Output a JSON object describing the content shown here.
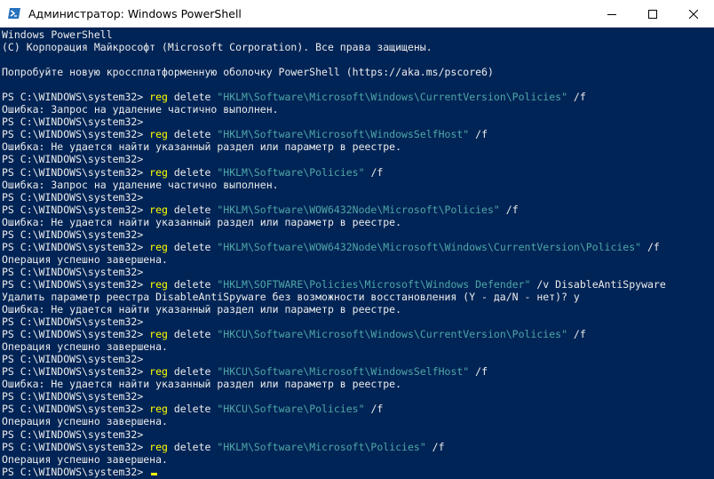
{
  "window": {
    "title": "Администратор: Windows PowerShell",
    "icon": "powershell-icon",
    "controls": [
      "minimize-icon",
      "maximize-icon",
      "close-icon"
    ]
  },
  "colors": {
    "background": "#012456",
    "text": "#ececec",
    "command": "#ffff00",
    "string": "#4fa6a6"
  },
  "console": {
    "lines": [
      {
        "type": "text",
        "text": "Windows PowerShell"
      },
      {
        "type": "text",
        "text": "(C) Корпорация Майкрософт (Microsoft Corporation). Все права защищены."
      },
      {
        "type": "text",
        "text": ""
      },
      {
        "type": "text",
        "text": "Попробуйте новую кроссплатформенную оболочку PowerShell (https://aka.ms/pscore6)"
      },
      {
        "type": "text",
        "text": ""
      },
      {
        "type": "cmd",
        "prompt": "PS C:\\WINDOWS\\system32> ",
        "command": "reg",
        "args": " delete ",
        "path": "\"HKLM\\Software\\Microsoft\\Windows\\CurrentVersion\\Policies\"",
        "tail": " /f"
      },
      {
        "type": "text",
        "text": "Ошибка: Запрос на удаление частично выполнен."
      },
      {
        "type": "text",
        "text": "PS C:\\WINDOWS\\system32>"
      },
      {
        "type": "cmd",
        "prompt": "PS C:\\WINDOWS\\system32> ",
        "command": "reg",
        "args": " delete ",
        "path": "\"HKLM\\Software\\Microsoft\\WindowsSelfHost\"",
        "tail": " /f"
      },
      {
        "type": "text",
        "text": "Ошибка: Не удается найти указанный раздел или параметр в реестре."
      },
      {
        "type": "text",
        "text": "PS C:\\WINDOWS\\system32>"
      },
      {
        "type": "cmd",
        "prompt": "PS C:\\WINDOWS\\system32> ",
        "command": "reg",
        "args": " delete ",
        "path": "\"HKLM\\Software\\Policies\"",
        "tail": " /f"
      },
      {
        "type": "text",
        "text": "Ошибка: Запрос на удаление частично выполнен."
      },
      {
        "type": "text",
        "text": "PS C:\\WINDOWS\\system32>"
      },
      {
        "type": "cmd",
        "prompt": "PS C:\\WINDOWS\\system32> ",
        "command": "reg",
        "args": " delete ",
        "path": "\"HKLM\\Software\\WOW6432Node\\Microsoft\\Policies\"",
        "tail": " /f"
      },
      {
        "type": "text",
        "text": "Ошибка: Не удается найти указанный раздел или параметр в реестре."
      },
      {
        "type": "text",
        "text": "PS C:\\WINDOWS\\system32>"
      },
      {
        "type": "cmd",
        "prompt": "PS C:\\WINDOWS\\system32> ",
        "command": "reg",
        "args": " delete ",
        "path": "\"HKLM\\Software\\WOW6432Node\\Microsoft\\Windows\\CurrentVersion\\Policies\"",
        "tail": " /f"
      },
      {
        "type": "text",
        "text": "Операция успешно завершена."
      },
      {
        "type": "text",
        "text": "PS C:\\WINDOWS\\system32>"
      },
      {
        "type": "cmd",
        "prompt": "PS C:\\WINDOWS\\system32> ",
        "command": "reg",
        "args": " delete ",
        "path": "\"HKLM\\SOFTWARE\\Policies\\Microsoft\\Windows Defender\"",
        "tail": " /v DisableAntiSpyware"
      },
      {
        "type": "text",
        "text": "Удалить параметр реестра DisableAntiSpyware без возможности восстановления (Y - да/N - нет)? y"
      },
      {
        "type": "text",
        "text": "Ошибка: Не удается найти указанный раздел или параметр в реестре."
      },
      {
        "type": "text",
        "text": "PS C:\\WINDOWS\\system32>"
      },
      {
        "type": "cmd",
        "prompt": "PS C:\\WINDOWS\\system32> ",
        "command": "reg",
        "args": " delete ",
        "path": "\"HKCU\\Software\\Microsoft\\Windows\\CurrentVersion\\Policies\"",
        "tail": " /f"
      },
      {
        "type": "text",
        "text": "Операция успешно завершена."
      },
      {
        "type": "text",
        "text": "PS C:\\WINDOWS\\system32>"
      },
      {
        "type": "cmd",
        "prompt": "PS C:\\WINDOWS\\system32> ",
        "command": "reg",
        "args": " delete ",
        "path": "\"HKCU\\Software\\Microsoft\\WindowsSelfHost\"",
        "tail": " /f"
      },
      {
        "type": "text",
        "text": "Ошибка: Не удается найти указанный раздел или параметр в реестре."
      },
      {
        "type": "text",
        "text": "PS C:\\WINDOWS\\system32>"
      },
      {
        "type": "cmd",
        "prompt": "PS C:\\WINDOWS\\system32> ",
        "command": "reg",
        "args": " delete ",
        "path": "\"HKCU\\Software\\Policies\"",
        "tail": " /f"
      },
      {
        "type": "text",
        "text": "Операция успешно завершена."
      },
      {
        "type": "text",
        "text": "PS C:\\WINDOWS\\system32>"
      },
      {
        "type": "cmd",
        "prompt": "PS C:\\WINDOWS\\system32> ",
        "command": "reg",
        "args": " delete ",
        "path": "\"HKLM\\Software\\Microsoft\\Policies\"",
        "tail": " /f"
      },
      {
        "type": "text",
        "text": "Операция успешно завершена."
      },
      {
        "type": "prompt",
        "prompt": "PS C:\\WINDOWS\\system32> "
      }
    ]
  }
}
